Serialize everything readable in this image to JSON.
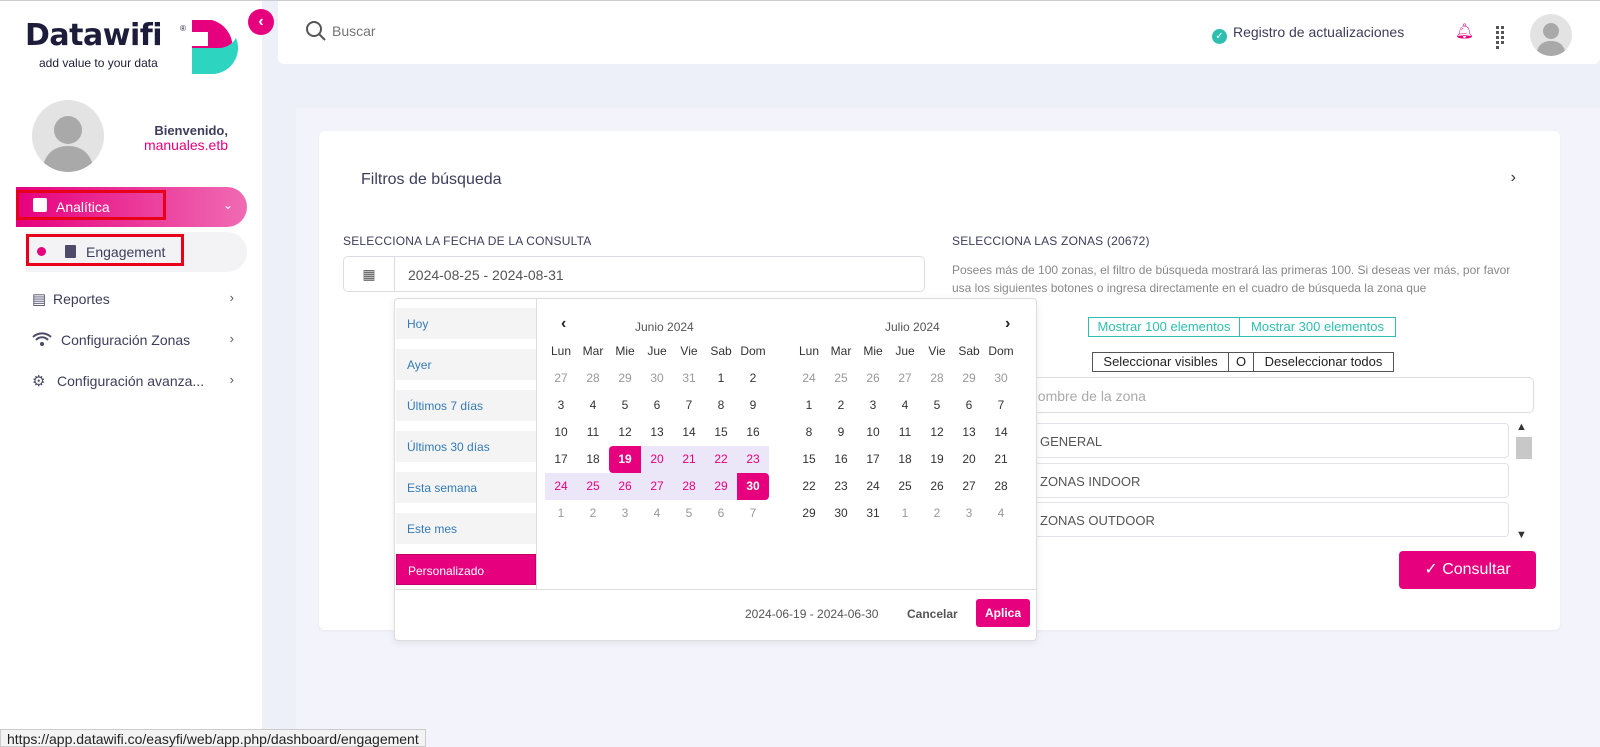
{
  "brand": {
    "name": "Datawifi",
    "registered": "®",
    "tagline": "add value to your data",
    "colors": {
      "primary": "#e6007e",
      "accent": "#2dbfb0",
      "dark": "#1d1d3b"
    }
  },
  "sidebar": {
    "welcome": "Bienvenido,",
    "username": "manuales.etb",
    "items": [
      {
        "label": "Analítica",
        "icon": "chart-icon"
      },
      {
        "label": "Engagement",
        "icon": "contact-book-icon"
      },
      {
        "label": "Reportes",
        "icon": "document-icon"
      },
      {
        "label": "Configuración Zonas",
        "icon": "wifi-icon"
      },
      {
        "label": "Configuración avanza...",
        "icon": "gear-icon"
      }
    ]
  },
  "topbar": {
    "search_placeholder": "Buscar",
    "updates_label": "Registro de actualizaciones"
  },
  "filters": {
    "title": "Filtros de búsqueda",
    "date_label": "SELECCIONA LA FECHA DE LA CONSULTA",
    "date_value": "2024-08-25 - 2024-08-31",
    "zones_label": "SELECCIONA LAS ZONAS (20672)",
    "zones_info": "Posees más de 100 zonas, el filtro de búsqueda mostrará las primeras 100. Si deseas ver más, por favor usa los siguientes botones o ingresa directamente en el cuadro de búsqueda la zona que",
    "show_100": "Mostrar 100 elementos",
    "show_300": "Mostrar 300 elementos",
    "select_visible": "Seleccionar visibles",
    "or": "O",
    "deselect_all": "Deseleccionar todos",
    "zone_search_placeholder": "nombre de la zona",
    "zones": [
      "GENERAL",
      "ZONAS INDOOR",
      "ZONAS OUTDOOR"
    ],
    "submit": "Consultar"
  },
  "picker": {
    "ranges": [
      "Hoy",
      "Ayer",
      "Últimos 7 días",
      "Últimos 30 días",
      "Esta semana",
      "Este mes",
      "Personalizado"
    ],
    "weekdays": [
      "Lun",
      "Mar",
      "Mie",
      "Jue",
      "Vie",
      "Sab",
      "Dom"
    ],
    "months": [
      {
        "title": "Junio 2024",
        "days": [
          [
            27,
            28,
            29,
            30,
            31,
            1,
            2
          ],
          [
            3,
            4,
            5,
            6,
            7,
            8,
            9
          ],
          [
            10,
            11,
            12,
            13,
            14,
            15,
            16
          ],
          [
            17,
            18,
            19,
            20,
            21,
            22,
            23
          ],
          [
            24,
            25,
            26,
            27,
            28,
            29,
            30
          ],
          [
            1,
            2,
            3,
            4,
            5,
            6,
            7
          ]
        ]
      },
      {
        "title": "Julio 2024",
        "days": [
          [
            24,
            25,
            26,
            27,
            28,
            29,
            30
          ],
          [
            1,
            2,
            3,
            4,
            5,
            6,
            7
          ],
          [
            8,
            9,
            10,
            11,
            12,
            13,
            14
          ],
          [
            15,
            16,
            17,
            18,
            19,
            20,
            21
          ],
          [
            22,
            23,
            24,
            25,
            26,
            27,
            28
          ],
          [
            29,
            30,
            31,
            1,
            2,
            3,
            4
          ]
        ]
      }
    ],
    "selected_range": "2024-06-19 - 2024-06-30",
    "cancel": "Cancelar",
    "apply": "Aplica"
  },
  "status_url": "https://app.datawifi.co/easyfi/web/app.php/dashboard/engagement"
}
